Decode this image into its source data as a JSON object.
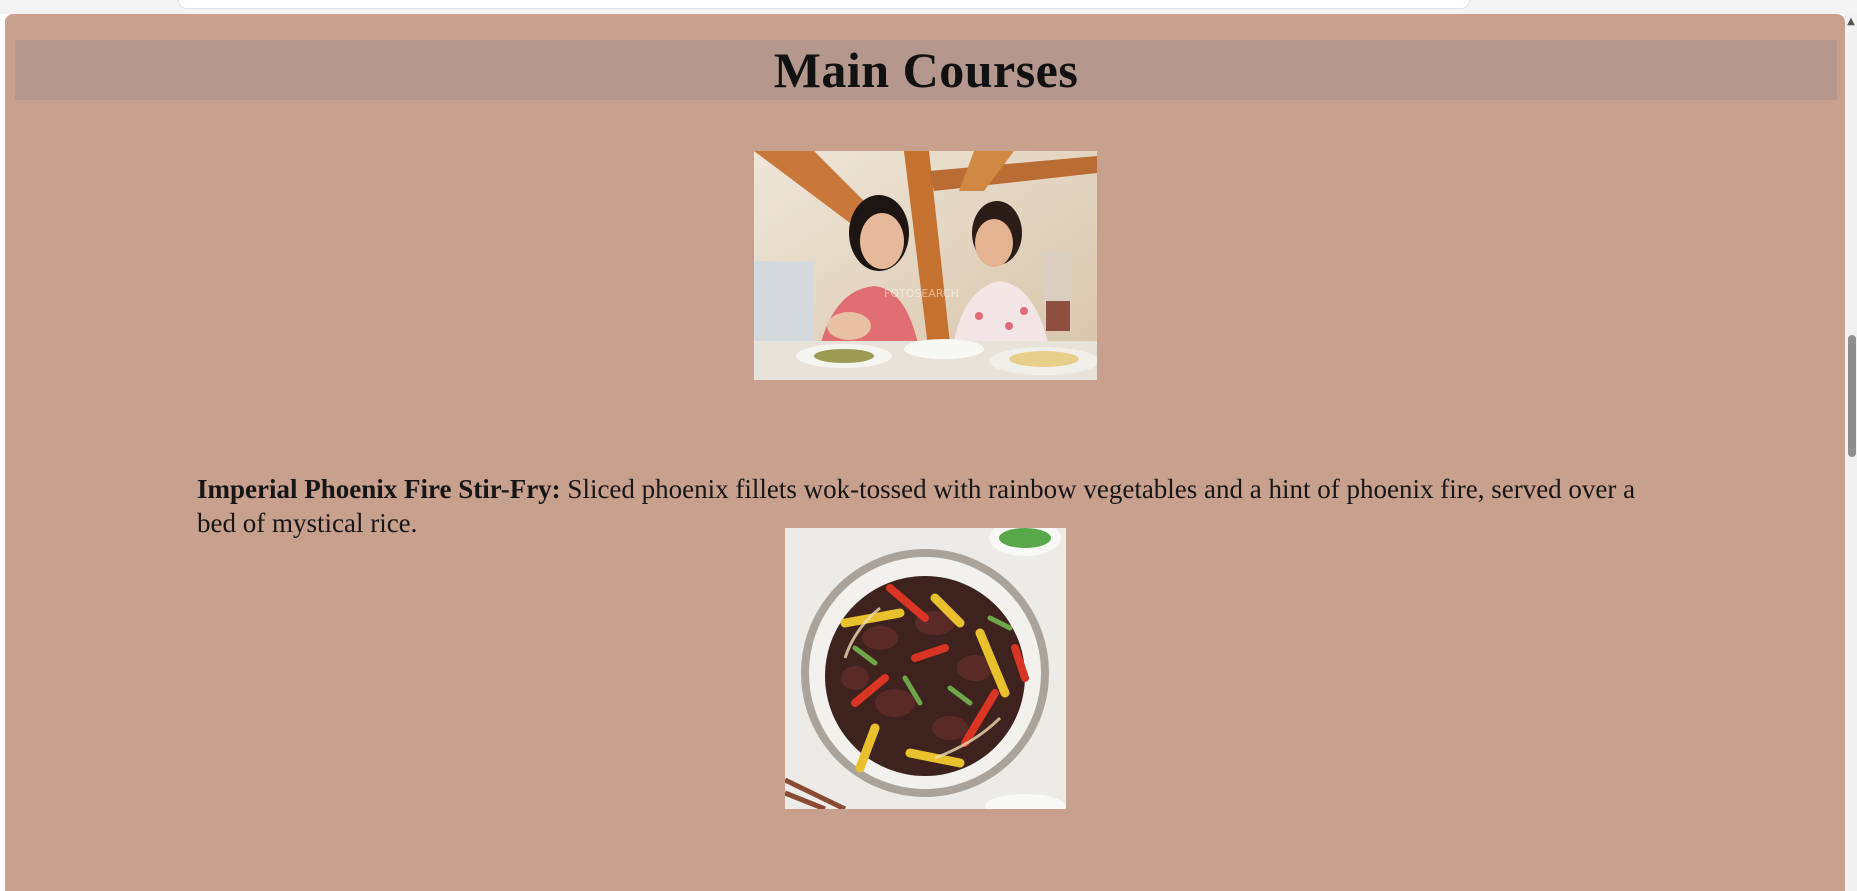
{
  "page": {
    "heading": "Main Courses"
  },
  "images": {
    "diners_alt": "Two people enjoying a meal at a restaurant",
    "stirfry_alt": "Plate of stir-fried meat with colorful peppers"
  },
  "dish": {
    "name": "Imperial Phoenix Fire Stir-Fry:",
    "description": " Sliced phoenix fillets wok-tossed with rainbow vegetables and a hint of phoenix fire, served over a bed of mystical rice."
  },
  "colors": {
    "page_background": "#c8a08e",
    "heading_band": "#b5988d"
  },
  "icons": {
    "scroll_up": "chevron-up-icon"
  }
}
